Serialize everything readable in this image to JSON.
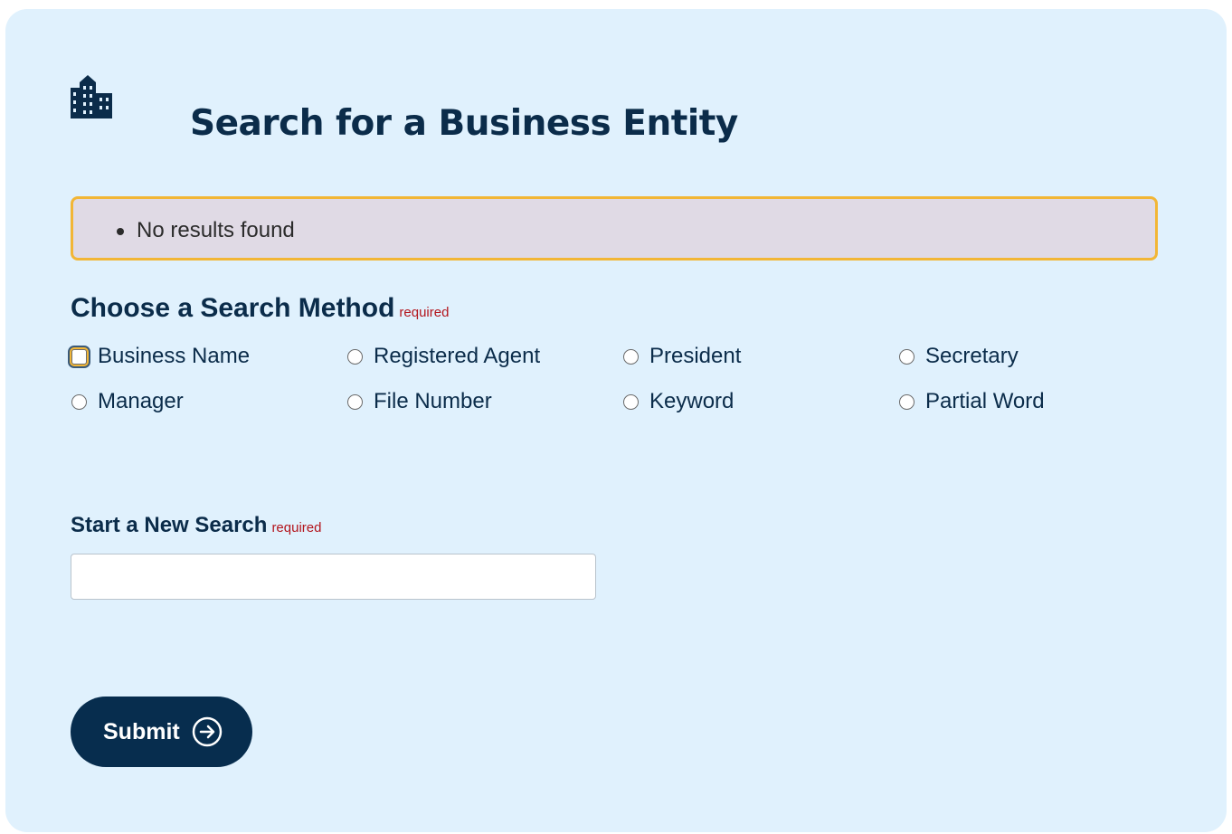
{
  "header": {
    "icon": "building-icon",
    "title": "Search for a Business Entity"
  },
  "alert": {
    "messages": [
      "No results found"
    ],
    "border_color": "#f2b636",
    "background": "#e0dae5"
  },
  "search_method": {
    "title": "Choose a Search Method",
    "required_label": "required",
    "options": [
      {
        "label": "Business Name",
        "selected": false,
        "focused": true
      },
      {
        "label": "Registered Agent",
        "selected": false
      },
      {
        "label": "President",
        "selected": false
      },
      {
        "label": "Secretary",
        "selected": false
      },
      {
        "label": "Manager",
        "selected": false
      },
      {
        "label": "File Number",
        "selected": false
      },
      {
        "label": "Keyword",
        "selected": false
      },
      {
        "label": "Partial Word",
        "selected": false
      }
    ]
  },
  "new_search": {
    "label": "Start a New Search",
    "required_label": "required",
    "value": "",
    "placeholder": ""
  },
  "submit": {
    "label": "Submit",
    "icon": "arrow-right-circle-icon"
  },
  "colors": {
    "panel_background": "#e0f1fd",
    "primary": "#072d4e",
    "required": "#b3151d",
    "focus": "#f2b636"
  }
}
